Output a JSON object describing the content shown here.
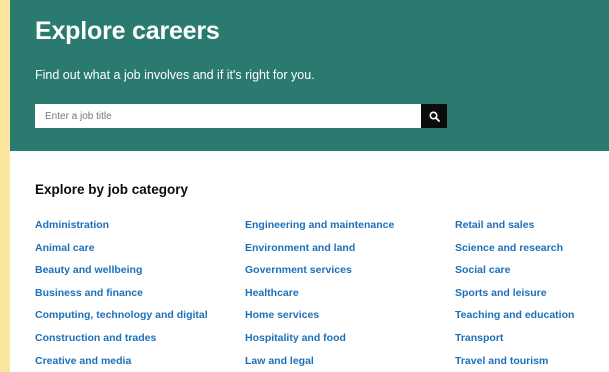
{
  "hero": {
    "title": "Explore careers",
    "subtitle": "Find out what a job involves and if it's right for you.",
    "search_placeholder": "Enter a job title",
    "search_icon": "search-icon"
  },
  "categories": {
    "heading": "Explore by job category",
    "col1": [
      "Administration",
      "Animal care",
      "Beauty and wellbeing",
      "Business and finance",
      "Computing, technology and digital",
      "Construction and trades",
      "Creative and media"
    ],
    "col2": [
      "Engineering and maintenance",
      "Environment and land",
      "Government services",
      "Healthcare",
      "Home services",
      "Hospitality and food",
      "Law and legal"
    ],
    "col3": [
      "Retail and sales",
      "Science and research",
      "Social care",
      "Sports and leisure",
      "Teaching and education",
      "Transport",
      "Travel and tourism"
    ]
  },
  "colors": {
    "hero_bg": "#2a7a6f",
    "link": "#1d70b8",
    "page_bg": "#fbe6a0"
  }
}
